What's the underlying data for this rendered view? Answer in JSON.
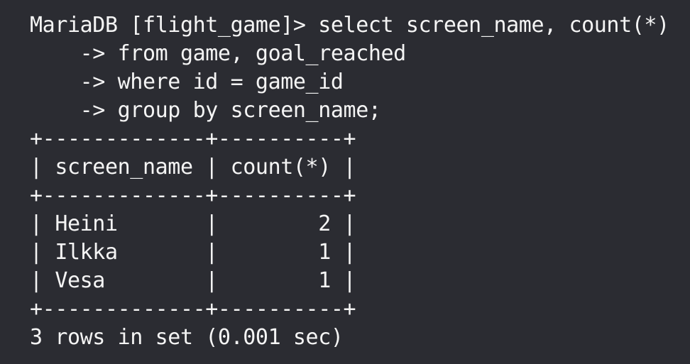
{
  "terminal": {
    "lines": [
      "MariaDB [flight_game]> select screen_name, count(*)",
      "    -> from game, goal_reached",
      "    -> where id = game_id",
      "    -> group by screen_name;",
      "+-------------+----------+",
      "| screen_name | count(*) |",
      "+-------------+----------+",
      "| Heini       |        2 |",
      "| Ilkka       |        1 |",
      "| Vesa        |        1 |",
      "+-------------+----------+",
      "3 rows in set (0.001 sec)"
    ]
  },
  "colors": {
    "background": "#2b2c32",
    "foreground": "#f4f4f4"
  }
}
